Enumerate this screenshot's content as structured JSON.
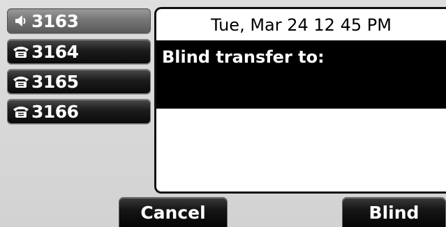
{
  "lines": [
    {
      "label": "3163",
      "icon": "speaker-icon",
      "state": "active"
    },
    {
      "label": "3164",
      "icon": "phone-icon",
      "state": "idle"
    },
    {
      "label": "3165",
      "icon": "phone-icon",
      "state": "idle"
    },
    {
      "label": "3166",
      "icon": "phone-icon",
      "state": "idle"
    }
  ],
  "header": {
    "datetime": "Tue, Mar 24  12 45 PM"
  },
  "transfer": {
    "prompt": "Blind transfer to:",
    "number": ""
  },
  "softkeys": {
    "cancel": "Cancel",
    "blind": "Blind"
  },
  "colors": {
    "background": "#d7d7d7",
    "key_dark": "#111111",
    "key_active": "#767676",
    "panel": "#ffffff",
    "highlight_band": "#000000",
    "text_light": "#ffffff",
    "text_dark": "#000000"
  }
}
